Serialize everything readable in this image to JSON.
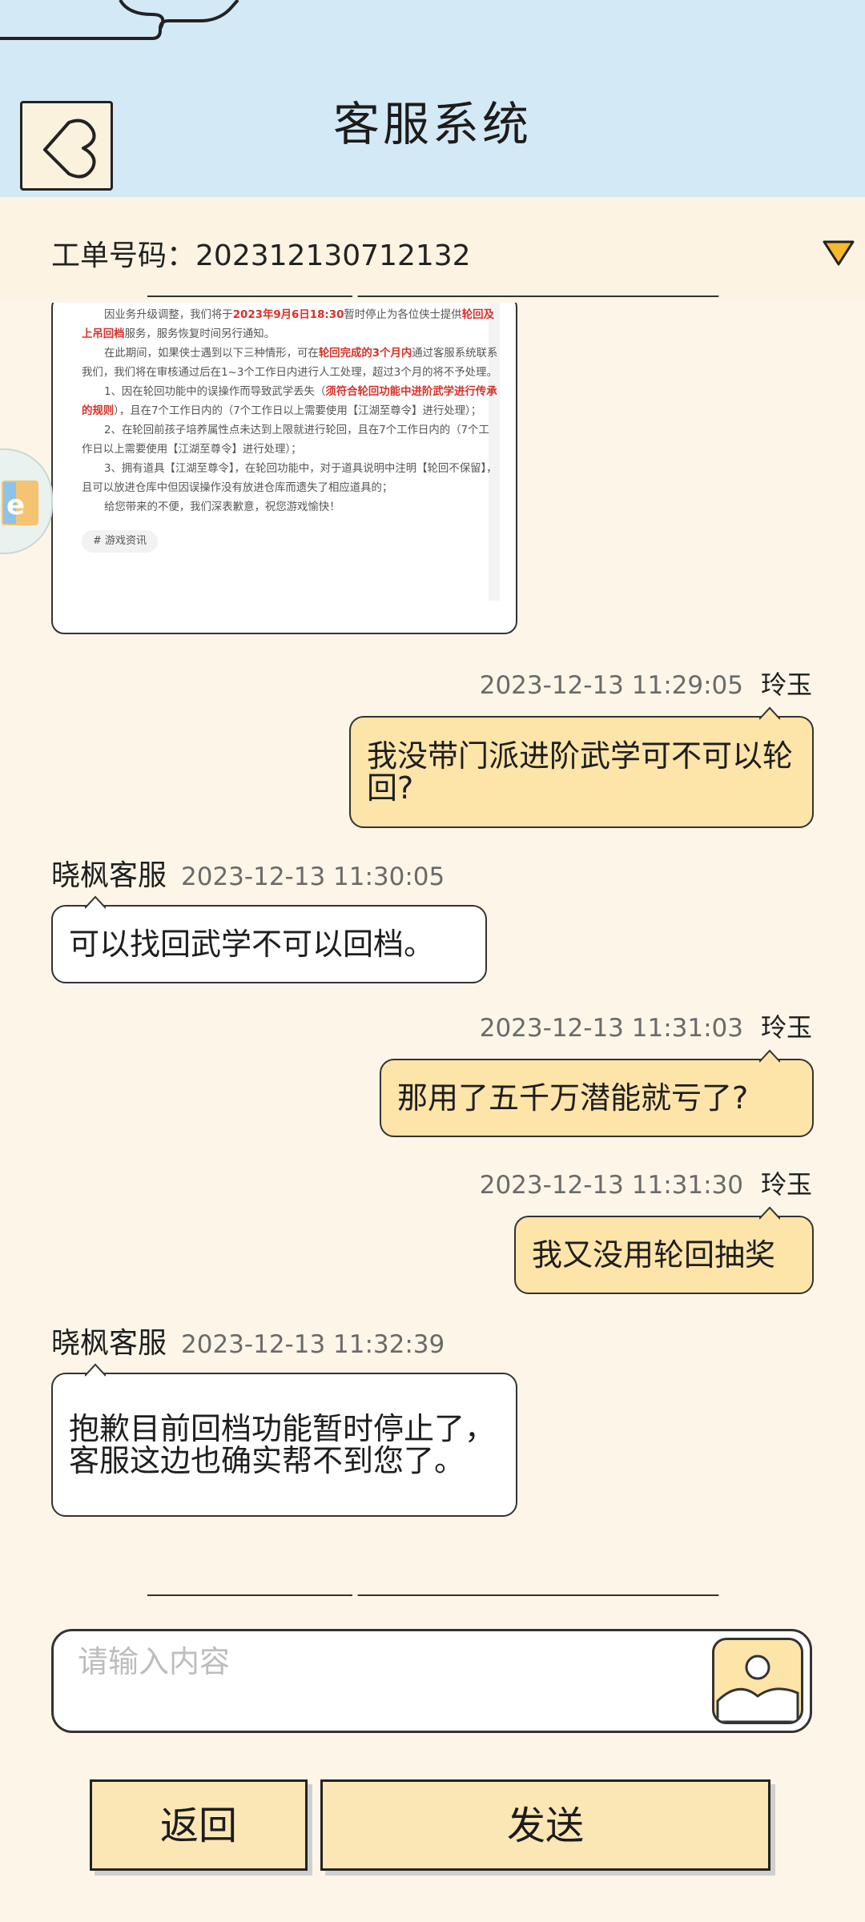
{
  "header": {
    "title": "客服系统",
    "back_icon": "back-chevron-icon",
    "bg_color": "#d4e9f6"
  },
  "ticket": {
    "label": "工单号码：",
    "number": "202312130712132",
    "dropdown_icon": "triangle-down-icon",
    "dropdown_color": "#f5b82e"
  },
  "article": {
    "p1_a": "因业务升级调整，我们将于",
    "p1_date": "2023年9月6日18:30",
    "p1_b": "暂时停止为各位侠士提供",
    "p1_c": "轮回及上吊回档",
    "p1_d": "服务，服务恢复时间另行通知。",
    "p2_a": "在此期间，如果侠士遇到以下三种情形，可在",
    "p2_b": "轮回完成的3个月内",
    "p2_c": "通过客服系统联系我们，我们将在审核通过后在1~3个工作日内进行人工处理，超过3个月的将不予处理。",
    "p3_a": "1、因在轮回功能中的误操作而导致武学丢失（",
    "p3_b": "须符合轮回功能中进阶武学进行传承的规则",
    "p3_c": "），且在7个工作日内的（7个工作日以上需要使用【江湖至尊令】进行处理）；",
    "p4": "2、在轮回前孩子培养属性点未达到上限就进行轮回，且在7个工作日内的（7个工作日以上需要使用【江湖至尊令】进行处理）；",
    "p5": "3、拥有道具【江湖至尊令】，在轮回功能中，对于道具说明中注明【轮回不保留】，且可以放进仓库中但因误操作没有放进仓库而遗失了相应道具的；",
    "p6": "给您带来的不便，我们深表歉意，祝您游戏愉快！",
    "tag": "# 游戏资讯"
  },
  "messages": [
    {
      "sender": "玲玉",
      "time": "2023-12-13 11:29:05",
      "text": "我没带门派进阶武学可不可以轮回?"
    },
    {
      "sender": "晓枫客服",
      "time": "2023-12-13 11:30:05",
      "text": "可以找回武学不可以回档。"
    },
    {
      "sender": "玲玉",
      "time": "2023-12-13 11:31:03",
      "text": "那用了五千万潜能就亏了?"
    },
    {
      "sender": "玲玉",
      "time": "2023-12-13 11:31:30",
      "text": "我又没用轮回抽奖"
    },
    {
      "sender": "晓枫客服",
      "time": "2023-12-13 11:32:39",
      "text": "抱歉目前回档功能暂时停止了，客服这边也确实帮不到您了。"
    }
  ],
  "colors": {
    "my_bubble": "#fde4a9",
    "their_bubble": "#ffffff",
    "page_bg": "#fdf6e8"
  },
  "input": {
    "placeholder": "请输入内容",
    "image_icon": "image-upload-icon"
  },
  "buttons": {
    "back_label": "返回",
    "send_label": "发送"
  }
}
